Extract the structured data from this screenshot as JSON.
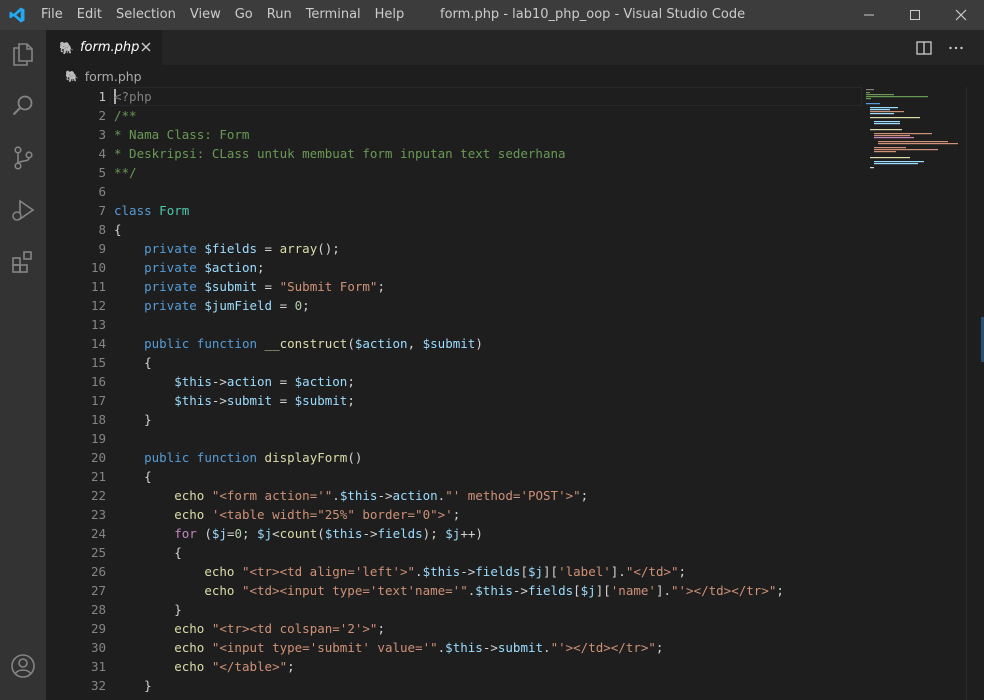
{
  "window": {
    "title": "form.php - lab10_php_oop - Visual Studio Code",
    "menus": [
      "File",
      "Edit",
      "Selection",
      "View",
      "Go",
      "Run",
      "Terminal",
      "Help"
    ]
  },
  "activity_bar": {
    "icons": [
      "explorer-icon",
      "search-icon",
      "source-control-icon",
      "run-debug-icon",
      "extensions-icon",
      "accounts-icon"
    ]
  },
  "tab": {
    "label": "form.php",
    "icon": "php-elephant-icon"
  },
  "breadcrumb": {
    "label": "form.php"
  },
  "colors": {
    "keyword": "#569cd6",
    "variable": "#9cdcfe",
    "function": "#dcdcaa",
    "string": "#ce9178",
    "number": "#b5cea8",
    "comment": "#6a9955",
    "class": "#4ec9b0",
    "control": "#c586c0",
    "php_icon": "#a074c4"
  },
  "editor": {
    "active_line": 1,
    "lines": [
      {
        "n": "1",
        "t": [
          {
            "c": "tag",
            "s": "<?php"
          }
        ]
      },
      {
        "n": "2",
        "t": [
          {
            "c": "cmt",
            "s": "/**"
          }
        ]
      },
      {
        "n": "3",
        "t": [
          {
            "c": "cmt",
            "s": "* Nama Class: Form"
          }
        ]
      },
      {
        "n": "4",
        "t": [
          {
            "c": "cmt",
            "s": "* Deskripsi: CLass untuk membuat form inputan text sederhana"
          }
        ]
      },
      {
        "n": "5",
        "t": [
          {
            "c": "cmt",
            "s": "**/"
          }
        ]
      },
      {
        "n": "6",
        "t": []
      },
      {
        "n": "7",
        "t": [
          {
            "c": "kw",
            "s": "class"
          },
          {
            "c": "op",
            "s": " "
          },
          {
            "c": "cls",
            "s": "Form"
          }
        ]
      },
      {
        "n": "8",
        "t": [
          {
            "c": "op",
            "s": "{"
          }
        ]
      },
      {
        "n": "9",
        "t": [
          {
            "c": "op",
            "s": "    "
          },
          {
            "c": "kw",
            "s": "private"
          },
          {
            "c": "op",
            "s": " "
          },
          {
            "c": "var",
            "s": "$fields"
          },
          {
            "c": "op",
            "s": " = "
          },
          {
            "c": "fn",
            "s": "array"
          },
          {
            "c": "op",
            "s": "();"
          }
        ]
      },
      {
        "n": "10",
        "t": [
          {
            "c": "op",
            "s": "    "
          },
          {
            "c": "kw",
            "s": "private"
          },
          {
            "c": "op",
            "s": " "
          },
          {
            "c": "var",
            "s": "$action"
          },
          {
            "c": "op",
            "s": ";"
          }
        ]
      },
      {
        "n": "11",
        "t": [
          {
            "c": "op",
            "s": "    "
          },
          {
            "c": "kw",
            "s": "private"
          },
          {
            "c": "op",
            "s": " "
          },
          {
            "c": "var",
            "s": "$submit"
          },
          {
            "c": "op",
            "s": " = "
          },
          {
            "c": "str",
            "s": "\"Submit Form\""
          },
          {
            "c": "op",
            "s": ";"
          }
        ]
      },
      {
        "n": "12",
        "t": [
          {
            "c": "op",
            "s": "    "
          },
          {
            "c": "kw",
            "s": "private"
          },
          {
            "c": "op",
            "s": " "
          },
          {
            "c": "var",
            "s": "$jumField"
          },
          {
            "c": "op",
            "s": " = "
          },
          {
            "c": "num",
            "s": "0"
          },
          {
            "c": "op",
            "s": ";"
          }
        ]
      },
      {
        "n": "13",
        "t": []
      },
      {
        "n": "14",
        "t": [
          {
            "c": "op",
            "s": "    "
          },
          {
            "c": "kw",
            "s": "public"
          },
          {
            "c": "op",
            "s": " "
          },
          {
            "c": "kw",
            "s": "function"
          },
          {
            "c": "op",
            "s": " "
          },
          {
            "c": "fn",
            "s": "__construct"
          },
          {
            "c": "op",
            "s": "("
          },
          {
            "c": "var",
            "s": "$action"
          },
          {
            "c": "op",
            "s": ", "
          },
          {
            "c": "var",
            "s": "$submit"
          },
          {
            "c": "op",
            "s": ")"
          }
        ]
      },
      {
        "n": "15",
        "t": [
          {
            "c": "op",
            "s": "    {"
          }
        ]
      },
      {
        "n": "16",
        "t": [
          {
            "c": "op",
            "s": "        "
          },
          {
            "c": "var",
            "s": "$this"
          },
          {
            "c": "op",
            "s": "->"
          },
          {
            "c": "var",
            "s": "action"
          },
          {
            "c": "op",
            "s": " = "
          },
          {
            "c": "var",
            "s": "$action"
          },
          {
            "c": "op",
            "s": ";"
          }
        ]
      },
      {
        "n": "17",
        "t": [
          {
            "c": "op",
            "s": "        "
          },
          {
            "c": "var",
            "s": "$this"
          },
          {
            "c": "op",
            "s": "->"
          },
          {
            "c": "var",
            "s": "submit"
          },
          {
            "c": "op",
            "s": " = "
          },
          {
            "c": "var",
            "s": "$submit"
          },
          {
            "c": "op",
            "s": ";"
          }
        ]
      },
      {
        "n": "18",
        "t": [
          {
            "c": "op",
            "s": "    }"
          }
        ]
      },
      {
        "n": "19",
        "t": []
      },
      {
        "n": "20",
        "t": [
          {
            "c": "op",
            "s": "    "
          },
          {
            "c": "kw",
            "s": "public"
          },
          {
            "c": "op",
            "s": " "
          },
          {
            "c": "kw",
            "s": "function"
          },
          {
            "c": "op",
            "s": " "
          },
          {
            "c": "fn",
            "s": "displayForm"
          },
          {
            "c": "op",
            "s": "()"
          }
        ]
      },
      {
        "n": "21",
        "t": [
          {
            "c": "op",
            "s": "    {"
          }
        ]
      },
      {
        "n": "22",
        "t": [
          {
            "c": "op",
            "s": "        "
          },
          {
            "c": "fn",
            "s": "echo"
          },
          {
            "c": "op",
            "s": " "
          },
          {
            "c": "str",
            "s": "\"<form action='\""
          },
          {
            "c": "op",
            "s": "."
          },
          {
            "c": "var",
            "s": "$this"
          },
          {
            "c": "op",
            "s": "->"
          },
          {
            "c": "var",
            "s": "action"
          },
          {
            "c": "op",
            "s": "."
          },
          {
            "c": "str",
            "s": "\"' method='POST'>\""
          },
          {
            "c": "op",
            "s": ";"
          }
        ]
      },
      {
        "n": "23",
        "t": [
          {
            "c": "op",
            "s": "        "
          },
          {
            "c": "fn",
            "s": "echo"
          },
          {
            "c": "op",
            "s": " "
          },
          {
            "c": "str",
            "s": "'<table width=\"25%\" border=\"0\">'"
          },
          {
            "c": "op",
            "s": ";"
          }
        ]
      },
      {
        "n": "24",
        "t": [
          {
            "c": "op",
            "s": "        "
          },
          {
            "c": "ctl",
            "s": "for"
          },
          {
            "c": "op",
            "s": " ("
          },
          {
            "c": "var",
            "s": "$j"
          },
          {
            "c": "op",
            "s": "="
          },
          {
            "c": "num",
            "s": "0"
          },
          {
            "c": "op",
            "s": "; "
          },
          {
            "c": "var",
            "s": "$j"
          },
          {
            "c": "op",
            "s": "<"
          },
          {
            "c": "fn",
            "s": "count"
          },
          {
            "c": "op",
            "s": "("
          },
          {
            "c": "var",
            "s": "$this"
          },
          {
            "c": "op",
            "s": "->"
          },
          {
            "c": "var",
            "s": "fields"
          },
          {
            "c": "op",
            "s": "); "
          },
          {
            "c": "var",
            "s": "$j"
          },
          {
            "c": "op",
            "s": "++)"
          }
        ]
      },
      {
        "n": "25",
        "t": [
          {
            "c": "op",
            "s": "        {"
          }
        ]
      },
      {
        "n": "26",
        "t": [
          {
            "c": "op",
            "s": "            "
          },
          {
            "c": "fn",
            "s": "echo"
          },
          {
            "c": "op",
            "s": " "
          },
          {
            "c": "str",
            "s": "\"<tr><td align='left'>\""
          },
          {
            "c": "op",
            "s": "."
          },
          {
            "c": "var",
            "s": "$this"
          },
          {
            "c": "op",
            "s": "->"
          },
          {
            "c": "var",
            "s": "fields"
          },
          {
            "c": "op",
            "s": "["
          },
          {
            "c": "var",
            "s": "$j"
          },
          {
            "c": "op",
            "s": "]["
          },
          {
            "c": "str",
            "s": "'label'"
          },
          {
            "c": "op",
            "s": "]."
          },
          {
            "c": "str",
            "s": "\"</td>\""
          },
          {
            "c": "op",
            "s": ";"
          }
        ]
      },
      {
        "n": "27",
        "t": [
          {
            "c": "op",
            "s": "            "
          },
          {
            "c": "fn",
            "s": "echo"
          },
          {
            "c": "op",
            "s": " "
          },
          {
            "c": "str",
            "s": "\"<td><input type='text'name='\""
          },
          {
            "c": "op",
            "s": "."
          },
          {
            "c": "var",
            "s": "$this"
          },
          {
            "c": "op",
            "s": "->"
          },
          {
            "c": "var",
            "s": "fields"
          },
          {
            "c": "op",
            "s": "["
          },
          {
            "c": "var",
            "s": "$j"
          },
          {
            "c": "op",
            "s": "]["
          },
          {
            "c": "str",
            "s": "'name'"
          },
          {
            "c": "op",
            "s": "]."
          },
          {
            "c": "str",
            "s": "\"'></td></tr>\""
          },
          {
            "c": "op",
            "s": ";"
          }
        ]
      },
      {
        "n": "28",
        "t": [
          {
            "c": "op",
            "s": "        }"
          }
        ]
      },
      {
        "n": "29",
        "t": [
          {
            "c": "op",
            "s": "        "
          },
          {
            "c": "fn",
            "s": "echo"
          },
          {
            "c": "op",
            "s": " "
          },
          {
            "c": "str",
            "s": "\"<tr><td colspan='2'>\""
          },
          {
            "c": "op",
            "s": ";"
          }
        ]
      },
      {
        "n": "30",
        "t": [
          {
            "c": "op",
            "s": "        "
          },
          {
            "c": "fn",
            "s": "echo"
          },
          {
            "c": "op",
            "s": " "
          },
          {
            "c": "str",
            "s": "\"<input type='submit' value='\""
          },
          {
            "c": "op",
            "s": "."
          },
          {
            "c": "var",
            "s": "$this"
          },
          {
            "c": "op",
            "s": "->"
          },
          {
            "c": "var",
            "s": "submit"
          },
          {
            "c": "op",
            "s": "."
          },
          {
            "c": "str",
            "s": "\"'></td></tr>\""
          },
          {
            "c": "op",
            "s": ";"
          }
        ]
      },
      {
        "n": "31",
        "t": [
          {
            "c": "op",
            "s": "        "
          },
          {
            "c": "fn",
            "s": "echo"
          },
          {
            "c": "op",
            "s": " "
          },
          {
            "c": "str",
            "s": "\"</table>\""
          },
          {
            "c": "op",
            "s": ";"
          }
        ]
      },
      {
        "n": "32",
        "t": [
          {
            "c": "op",
            "s": "    }"
          }
        ]
      }
    ]
  }
}
